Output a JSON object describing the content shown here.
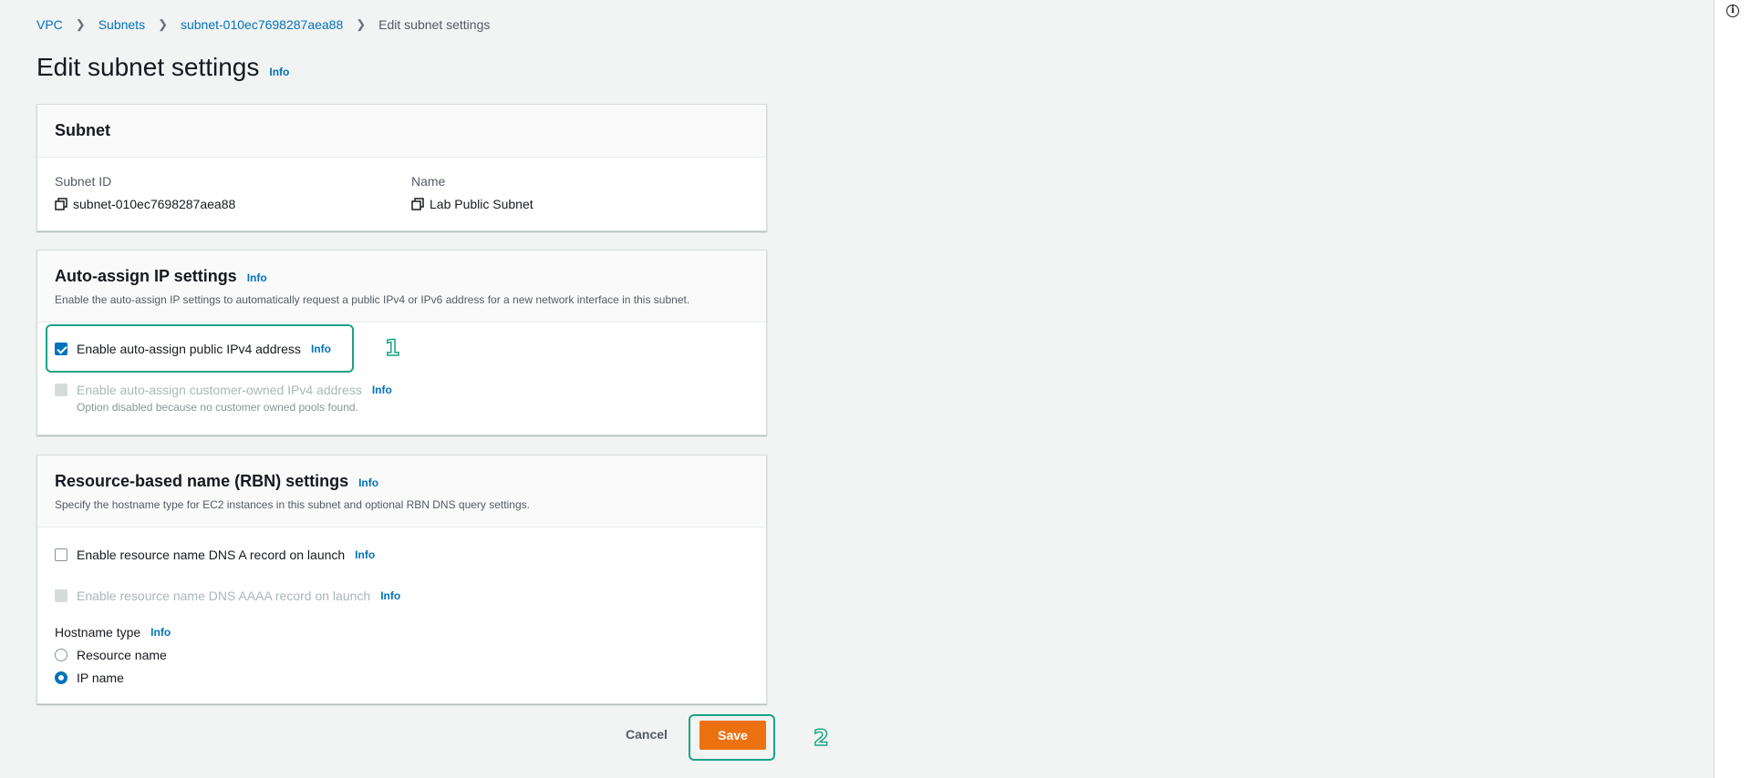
{
  "breadcrumb": {
    "items": [
      "VPC",
      "Subnets",
      "subnet-010ec7698287aea88"
    ],
    "current": "Edit subnet settings"
  },
  "page": {
    "title": "Edit subnet settings",
    "info": "Info"
  },
  "subnet_panel": {
    "title": "Subnet",
    "subnet_id_label": "Subnet ID",
    "subnet_id_value": "subnet-010ec7698287aea88",
    "name_label": "Name",
    "name_value": "Lab Public Subnet"
  },
  "auto_assign_panel": {
    "title": "Auto-assign IP settings",
    "info": "Info",
    "description": "Enable the auto-assign IP settings to automatically request a public IPv4 or IPv6 address for a new network interface in this subnet.",
    "public_ipv4": {
      "label": "Enable auto-assign public IPv4 address",
      "info": "Info",
      "checked": true
    },
    "customer_owned": {
      "label": "Enable auto-assign customer-owned IPv4 address",
      "info": "Info",
      "checked": false,
      "disabled": true,
      "note": "Option disabled because no customer owned pools found."
    }
  },
  "rbn_panel": {
    "title": "Resource-based name (RBN) settings",
    "info": "Info",
    "description": "Specify the hostname type for EC2 instances in this subnet and optional RBN DNS query settings.",
    "dns_a": {
      "label": "Enable resource name DNS A record on launch",
      "info": "Info",
      "checked": false
    },
    "dns_aaaa": {
      "label": "Enable resource name DNS AAAA record on launch",
      "info": "Info",
      "checked": false,
      "disabled": true
    },
    "hostname_type": {
      "label": "Hostname type",
      "info": "Info",
      "options": [
        "Resource name",
        "IP name"
      ],
      "selected": "IP name"
    }
  },
  "actions": {
    "cancel": "Cancel",
    "save": "Save"
  },
  "annotations": {
    "step1": "1",
    "step2": "2",
    "color": "#1aa383"
  },
  "colors": {
    "link": "#0073bb",
    "primary_button": "#ec7211",
    "checkbox_checked": "#0073bb"
  }
}
